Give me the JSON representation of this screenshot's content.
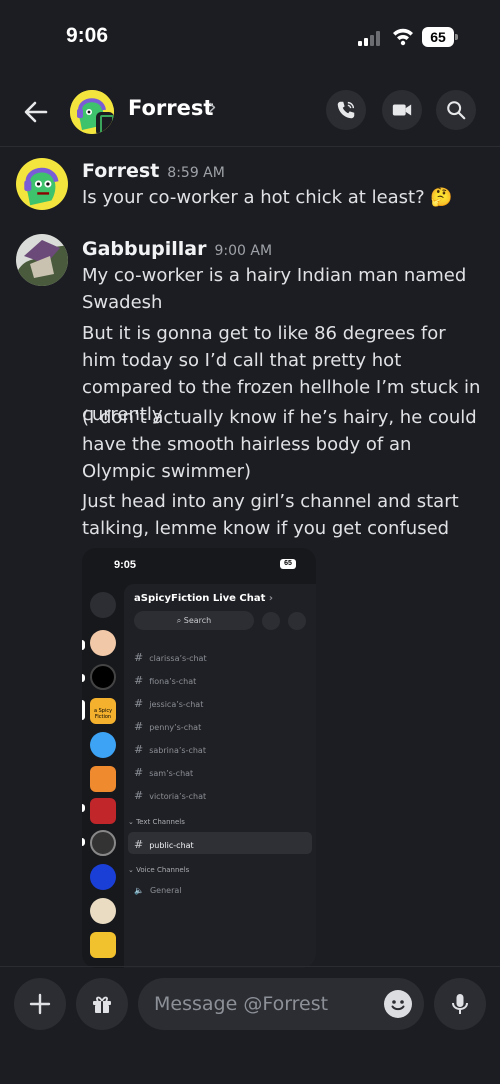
{
  "status_bar": {
    "time": "9:06",
    "battery": "65"
  },
  "header": {
    "title": "Forrest",
    "chevron": "›"
  },
  "messages": [
    {
      "author": "Forrest",
      "timestamp": "8:59 AM",
      "lines": [
        "Is your co-worker a hot chick at least? 🤔"
      ]
    },
    {
      "author": "Gabbupillar",
      "timestamp": "9:00 AM",
      "lines": [
        "My co-worker is a hairy Indian man named Swadesh",
        "But it is gonna get to like 86 degrees for him today so I’d call that pretty hot compared to the frozen hellhole I’m stuck in currently",
        "(I don’t actually know if he’s hairy, he could have the smooth hairless body of an Olympic swimmer)",
        "Just head into any girl’s channel and start talking, lemme know if you get confused"
      ]
    }
  ],
  "attachment": {
    "time": "9:05",
    "battery": "65",
    "server_title": "aSpicyFiction Live Chat",
    "chevron": "›",
    "search_label": "Search",
    "channels": [
      "clarissa’s-chat",
      "fiona’s-chat",
      "jessica’s-chat",
      "penny’s-chat",
      "sabrina’s-chat",
      "sam’s-chat",
      "victoria’s-chat"
    ],
    "category_text": "Text Channels",
    "active_channel": "public-chat",
    "category_voice": "Voice Channels",
    "voice_channel": "General",
    "server_badge": "a Spicy Fiction"
  },
  "composer": {
    "placeholder": "Message @Forrest"
  },
  "colors": {
    "background": "#1c1d22",
    "button": "#2b2d33",
    "text": "#dfe1e4",
    "muted": "#9ea2a8"
  }
}
